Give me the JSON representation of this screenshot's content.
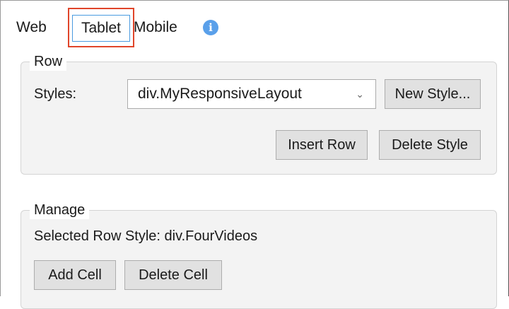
{
  "tabs": [
    "Web",
    "Tablet",
    "Mobile"
  ],
  "info_icon_glyph": "i",
  "row": {
    "legend": "Row",
    "styles_label": "Styles:",
    "selected_style": "div.MyResponsiveLayout",
    "new_style_button": "New Style...",
    "insert_row_button": "Insert Row",
    "delete_style_button": "Delete Style"
  },
  "manage": {
    "legend": "Manage",
    "selected_row_style": "Selected Row Style: div.FourVideos",
    "add_cell_button": "Add Cell",
    "delete_cell_button": "Delete Cell"
  },
  "colors": {
    "highlight": "#e0452a",
    "focus": "#4a9be0",
    "info": "#5aa0ea"
  },
  "icons": {
    "info": "info-icon",
    "dropdown": "chevron-down-icon"
  }
}
